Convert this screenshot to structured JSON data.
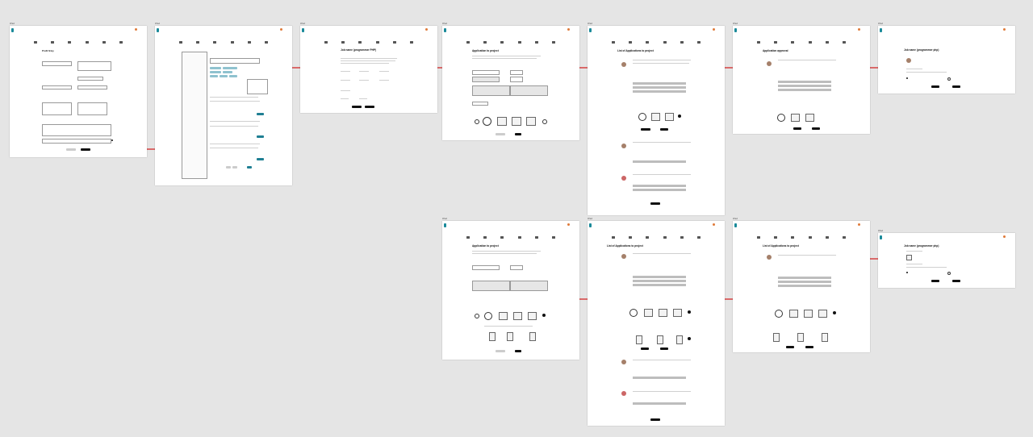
{
  "canvas": {
    "background": "#e5e5e5"
  },
  "frames": [
    {
      "id": "f1",
      "label": "iPad",
      "type": "profile-form",
      "heading": "Profil firmy"
    },
    {
      "id": "f2",
      "label": "iPad",
      "type": "search-list"
    },
    {
      "id": "f3",
      "label": "iPad",
      "type": "job-offer",
      "heading": "Job name (programmer PHP)"
    },
    {
      "id": "f4",
      "label": "iPad",
      "type": "application",
      "heading": "Application to project"
    },
    {
      "id": "f5",
      "label": "iPad",
      "type": "application-list",
      "heading": "List of Applications to project"
    },
    {
      "id": "f6",
      "label": "iPad",
      "type": "approval",
      "heading": "Application approval"
    },
    {
      "id": "f7",
      "label": "iPad",
      "type": "job-offer-small",
      "heading": "Job name (programmer php)"
    },
    {
      "id": "f8",
      "label": "iPad",
      "type": "application-long",
      "heading": "Application to project"
    },
    {
      "id": "f9",
      "label": "iPad",
      "type": "application-list",
      "heading": "List of Applications to project"
    },
    {
      "id": "f10",
      "label": "iPad",
      "type": "application-list-short",
      "heading": "List of Applications to project"
    },
    {
      "id": "f11",
      "label": "iPad",
      "type": "job-offer-small",
      "heading": "Job name (programmer php)"
    }
  ],
  "colors": {
    "accent": "#1f7f93",
    "arrow": "#d42020",
    "dark": "#111111"
  }
}
